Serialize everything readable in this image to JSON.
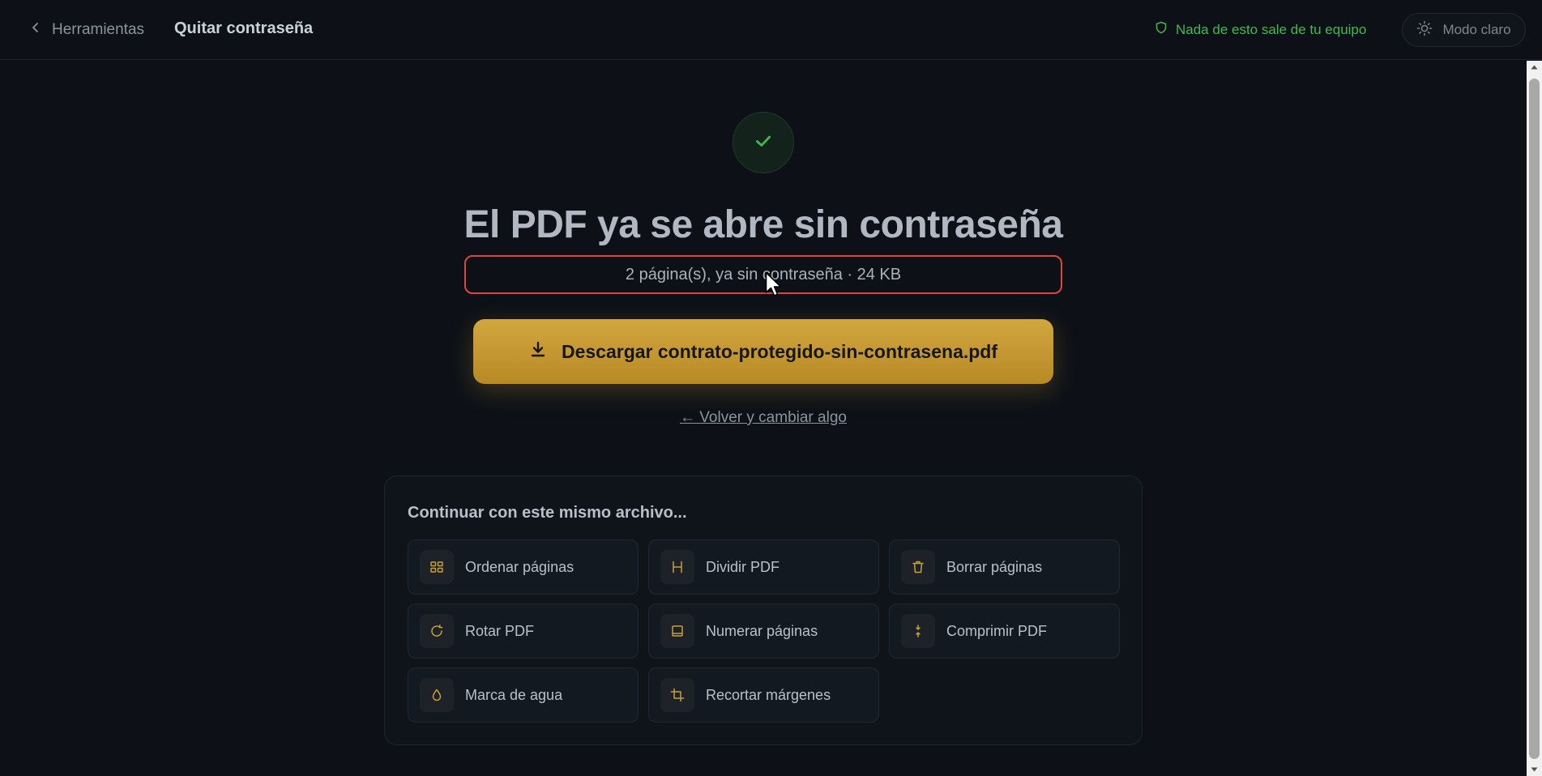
{
  "header": {
    "back_label": "Herramientas",
    "page_title": "Quitar contraseña",
    "privacy_note": "Nada de esto sale de tu equipo",
    "theme_toggle_label": "Modo claro"
  },
  "result": {
    "headline": "El PDF ya se abre sin contraseña",
    "file_meta": "2 página(s), ya sin contraseña · 24 KB",
    "download_label": "Descargar contrato-protegido-sin-contrasena.pdf",
    "back_link": "← Volver y cambiar algo"
  },
  "continue_panel": {
    "title": "Continuar con este mismo archivo...",
    "tools": [
      {
        "label": "Ordenar páginas",
        "icon": "grid-icon"
      },
      {
        "label": "Dividir PDF",
        "icon": "split-icon"
      },
      {
        "label": "Borrar páginas",
        "icon": "trash-icon"
      },
      {
        "label": "Rotar PDF",
        "icon": "rotate-icon"
      },
      {
        "label": "Numerar páginas",
        "icon": "page-number-icon"
      },
      {
        "label": "Comprimir PDF",
        "icon": "compress-icon"
      },
      {
        "label": "Marca de agua",
        "icon": "droplet-icon"
      },
      {
        "label": "Recortar márgenes",
        "icon": "crop-icon"
      }
    ]
  },
  "colors": {
    "background": "#0d1117",
    "accent_gold": "#c9a035",
    "success_green": "#3fb950",
    "highlight_red": "#e0453a"
  }
}
